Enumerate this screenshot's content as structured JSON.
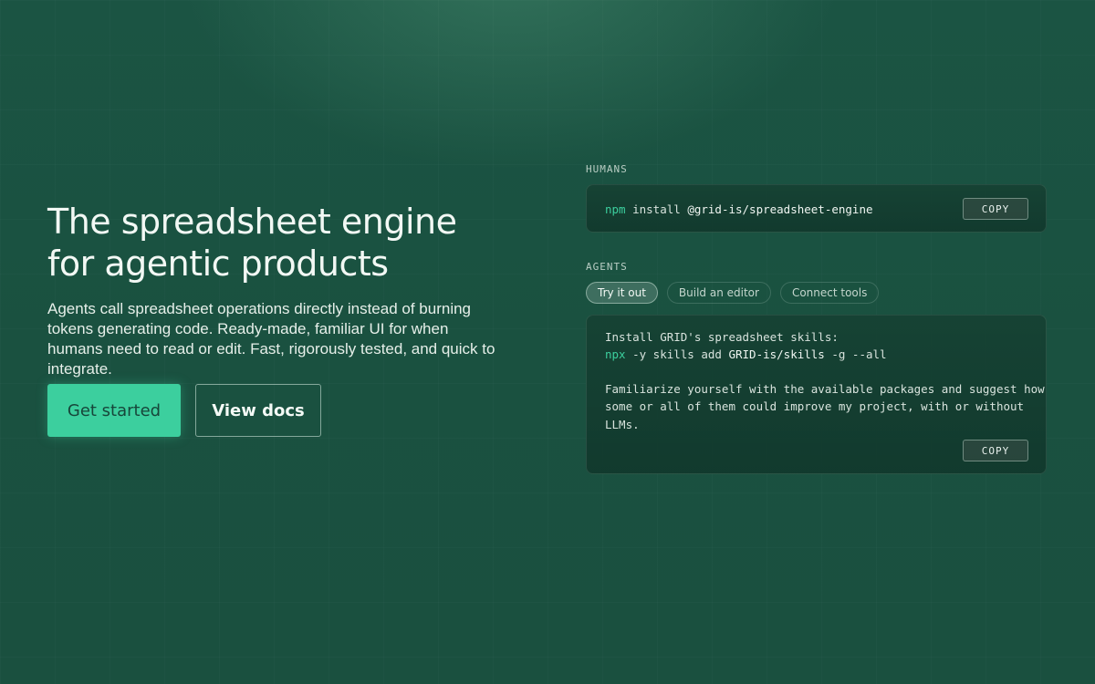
{
  "hero": {
    "title_line1": "The spreadsheet engine",
    "title_line2": "for agentic products",
    "description": "Agents call spreadsheet operations directly instead of burning tokens generating code. Ready-made, familiar UI for when humans need to read or edit. Fast, rigorously tested, and quick to integrate."
  },
  "buttons": {
    "primary_label": "Get started",
    "secondary_label": "View docs"
  },
  "humans": {
    "label": "HUMANS",
    "command_keyword": "npm",
    "command_verb": " install ",
    "command_package": "@grid-is/spreadsheet-engine",
    "copy_label": "COPY"
  },
  "agents": {
    "label": "AGENTS",
    "tabs": [
      {
        "label": "Try it out",
        "active": true
      },
      {
        "label": "Build an editor",
        "active": false
      },
      {
        "label": "Connect tools",
        "active": false
      }
    ],
    "line1": "Install GRID's spreadsheet skills:",
    "line2_keyword": "npx",
    "line2_part1": " -y skills add ",
    "line2_strong": "GRID-is/skills",
    "line2_part2": " -g --all",
    "line3": "Familiarize yourself with the available packages and suggest how",
    "line4": "some or all of them could improve my project, with or without",
    "line5": "LLMs.",
    "copy_label": "COPY"
  },
  "colors": {
    "accent": "#3ccf9e",
    "background": "#1a5140"
  }
}
